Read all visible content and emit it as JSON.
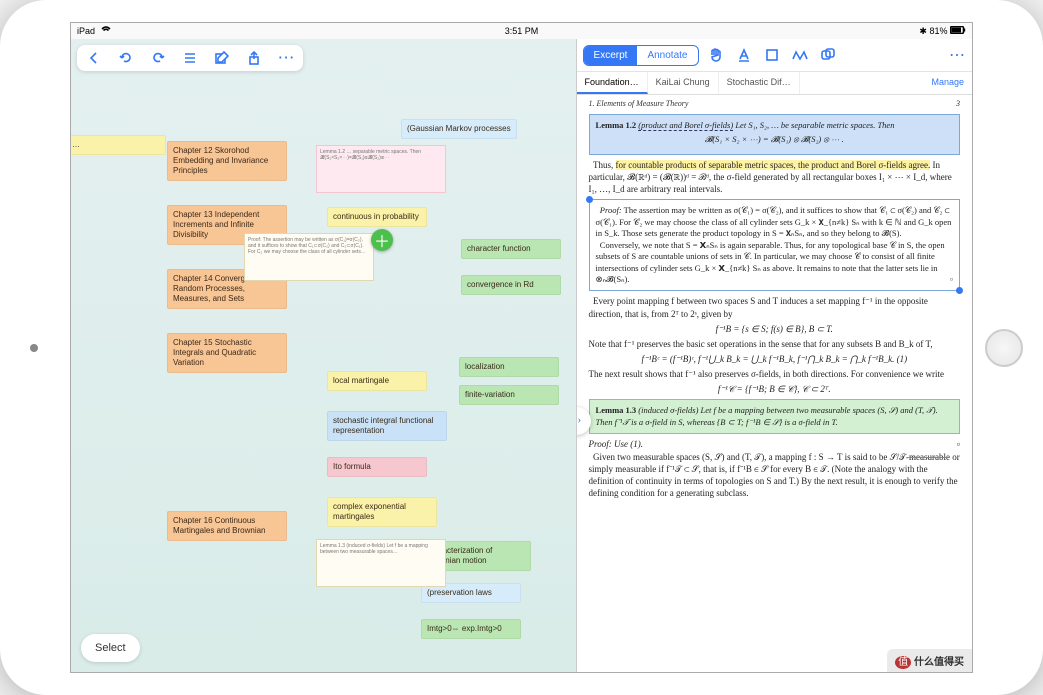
{
  "statusbar": {
    "device": "iPad",
    "time": "3:51 PM",
    "battery": "81%"
  },
  "mindmap_toolbar": {
    "back": "‹",
    "undo": "↺",
    "redo": "↻",
    "list": "≡",
    "edit": "✎",
    "share": "⇪",
    "more": "⋯"
  },
  "select_label": "Select",
  "nodes": {
    "ch12": "Chapter 12 Skorohod Embedding and Invariance Principles",
    "ch13": "Chapter 13 Independent Increments and Infinite Divisibility",
    "ch14": "Chapter 14 Convergence of Random Processes, Measures, and Sets",
    "ch15": "Chapter 15 Stochastic Integrals and Quadratic Variation",
    "ch16": "Chapter 16 Continuous Martingales and Brownian",
    "gauss": "(Gaussian Markov processes",
    "contprob": "continuous in probability",
    "charfn": "character function",
    "convrd": "convergence in Rd",
    "localmart": "local martingale",
    "localiz": "localization",
    "finvar": "finite-variation",
    "stochint": "stochastic integral functional representation",
    "ito": "Ito formula",
    "cxexp": "complex exponential martingales",
    "charbm": "characterization of Brownian motion",
    "preslaw": "(preservation laws",
    "imtg": "Imtg>0⇔ exp.Imtg>0"
  },
  "right_toolbar": {
    "excerpt": "Excerpt",
    "annotate": "Annotate"
  },
  "doc_tabs": [
    "Foundation…",
    "KaiLai Chung",
    "Stochastic Dif…"
  ],
  "manage": "Manage",
  "doc": {
    "header_left": "1. Elements of Measure Theory",
    "header_right": "3",
    "lemma12_title": "Lemma 1.2",
    "lemma12_sub": "(product and Borel σ-fields)",
    "lemma12_body1": "Let S₁, S₂, … be separable metric spaces. Then",
    "lemma12_eq": "𝓑(S₁ × S₂ × ⋯) = 𝓑(S₁) ⊗ 𝓑(S₂) ⊗ ⋯ .",
    "thus": "Thus, ",
    "hl1": "for countable products of separable metric spaces, the product and Borel σ-fields agree.",
    "thus2": " In particular, 𝓑(ℝᵈ) = (𝓑(ℝ))ᵈ = ℬᵈ, the σ-field generated by all rectangular boxes I₁ × ⋯ × I_d, where I₁, …, I_d are arbitrary real intervals.",
    "proof_label": "Proof:",
    "proof1": " The assertion may be written as σ(𝒞₁) = σ(𝒞₂), and it suffices to show that 𝒞₁ ⊂ σ(𝒞₂) and 𝒞₂ ⊂ σ(𝒞₁). For 𝒞₂ we may choose the class of all cylinder sets G_k × 𝗫_{n≠k} Sₙ with k ∈ ℕ and G_k open in S_k. Those sets generate the product topology in S = 𝗫ₙSₙ, and so they belong to 𝓑(S).",
    "proof2": "Conversely, we note that S = 𝗫ₙSₙ is again separable. Thus, for any topological base 𝒞 in S, the open subsets of S are countable unions of sets in 𝒞. In particular, we may choose 𝒞 to consist of all finite intersections of cylinder sets G_k × 𝗫_{n≠k} Sₙ as above. It remains to note that the latter sets lie in ⊗ₙ𝓑(Sₙ).",
    "para_map": "Every point mapping f between two spaces S and T induces a set mapping f⁻¹ in the opposite direction, that is, from 2ᵀ to 2ˢ, given by",
    "eq_map": "f⁻¹B = {s ∈ S; f(s) ∈ B},   B ⊂ T.",
    "para_preserve": "Note that f⁻¹ preserves the basic set operations in the sense that for any subsets B and B_k of T,",
    "eq_preserve": "f⁻¹Bᶜ = (f⁻¹B)ᶜ,   f⁻¹⋃_k B_k = ⋃_k f⁻¹B_k,   f⁻¹⋂_k B_k = ⋂_k f⁻¹B_k.    (1)",
    "para_next": "The next result shows that f⁻¹ also preserves σ-fields, in both directions. For convenience we write",
    "eq_next": "f⁻¹𝒞 = {f⁻¹B; B ∈ 𝒞},   𝒞 ⊂ 2ᵀ.",
    "lemma13_title": "Lemma 1.3",
    "lemma13_sub": "(induced σ-fields)",
    "lemma13_body": " Let f be a mapping between two measurable spaces (S, 𝒮) and (T, 𝒯). Then f⁻¹𝒯 is a σ-field in S, whereas {B ⊂ T; f⁻¹B ∈ 𝒮} is a σ-field in T.",
    "proof_use": "Proof: Use (1).",
    "para_given": "Given two measurable spaces (S, 𝒮) and (T, 𝒯), a mapping f : S → T is said to be 𝒮/𝒯-",
    "underline": "measurable",
    "para_given2": " or simply measurable if f⁻¹𝒯 ⊂ 𝒮, that is, if f⁻¹B ∈ 𝒮 for every B ∈ 𝒯. (Note the analogy with the definition of continuity in terms of topologies on S and T.) By the next result, it is enough to verify the defining condition for a generating subclass."
  },
  "watermark_a": "值",
  "watermark_b": "什么值得买"
}
